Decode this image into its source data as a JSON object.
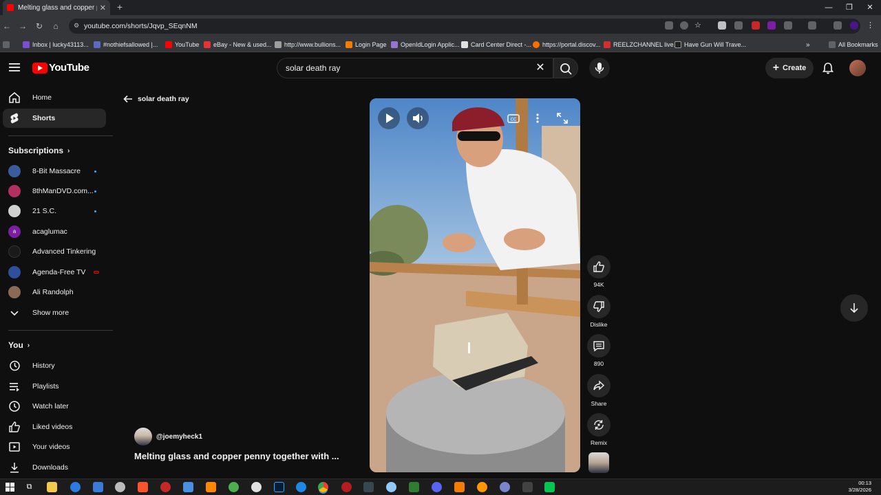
{
  "browser": {
    "tab_title": "Melting glass and copper penny together with ...",
    "tab_title_short": "Melting glass and copper penn",
    "url": "youtube.com/shorts/Jqvp_SEqnNM",
    "bookmarks": [
      {
        "label": "Inbox | lucky43113...",
        "color": "#7b4fd1"
      },
      {
        "label": "#nothiefsallowed |...",
        "color": "#5c6bc0"
      },
      {
        "label": "YouTube",
        "color": "#ff0000"
      },
      {
        "label": "eBay - New & used...",
        "color": "#e53238"
      },
      {
        "label": "http://www.bullions...",
        "color": "#9e9e9e"
      },
      {
        "label": "Login Page",
        "color": "#f57c00"
      },
      {
        "label": "OpenIdLogin Applic...",
        "color": "#9575cd"
      },
      {
        "label": "Card Center Direct -...",
        "color": "#e0e0e0"
      },
      {
        "label": "https://portal.discov...",
        "color": "#ff6f00"
      },
      {
        "label": "REELZCHANNEL live...",
        "color": "#d32f2f"
      },
      {
        "label": "Have Gun Will Trave...",
        "color": "#212121"
      }
    ],
    "all_bookmarks_label": "All Bookmarks"
  },
  "youtube": {
    "logo_text": "YouTube",
    "search_query": "solar death ray",
    "create_label": "Create"
  },
  "sidebar": {
    "main": [
      {
        "label": "Home",
        "icon": "home-icon"
      },
      {
        "label": "Shorts",
        "icon": "shorts-icon"
      }
    ],
    "subscriptions_heading": "Subscriptions",
    "subscriptions": [
      {
        "label": "8-Bit Massacre",
        "color": "#3b5b9a",
        "badge": "dot"
      },
      {
        "label": "8thManDVD.com...",
        "color": "#b03060",
        "badge": "dot"
      },
      {
        "label": "21 S.C.",
        "color": "#d0d0d0",
        "badge": "dot"
      },
      {
        "label": "acaglumac",
        "color": "#7b1fa2",
        "badge": ""
      },
      {
        "label": "Advanced Tinkering",
        "color": "#1a1a1a",
        "badge": ""
      },
      {
        "label": "Agenda-Free TV",
        "color": "#2f4f9a",
        "badge": "live"
      },
      {
        "label": "Ali Randolph",
        "color": "#8a6a55",
        "badge": ""
      }
    ],
    "show_more_label": "Show more",
    "you_heading": "You",
    "you_items": [
      {
        "label": "History",
        "icon": "history-icon"
      },
      {
        "label": "Playlists",
        "icon": "playlists-icon"
      },
      {
        "label": "Watch later",
        "icon": "watch-later-icon"
      },
      {
        "label": "Liked videos",
        "icon": "liked-icon"
      },
      {
        "label": "Your videos",
        "icon": "your-videos-icon"
      },
      {
        "label": "Downloads",
        "icon": "downloads-icon"
      }
    ]
  },
  "main": {
    "back_label": "solar death ray",
    "channel_handle": "@joemyheck1",
    "video_title": "Melting glass and copper penny together with ..."
  },
  "actions": {
    "like_count": "94K",
    "dislike_label": "Dislike",
    "comment_count": "890",
    "share_label": "Share",
    "remix_label": "Remix"
  },
  "taskbar": {
    "time": "00:13",
    "date": "3/28/2026"
  }
}
